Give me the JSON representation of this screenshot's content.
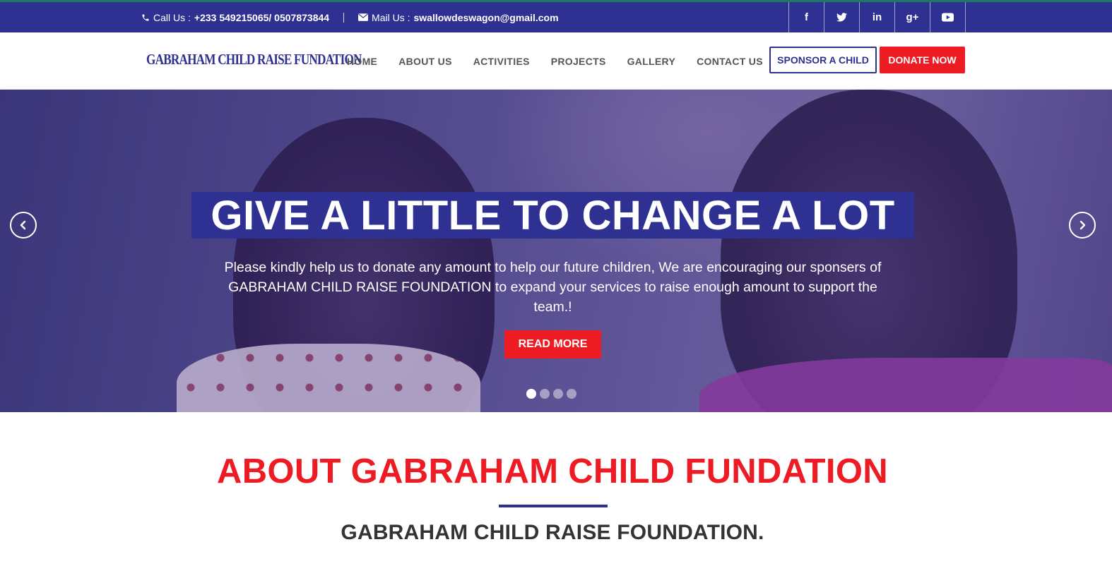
{
  "topbar": {
    "call_label": "Call Us :",
    "call_value": "+233 549215065/ 0507873844",
    "mail_label": "Mail Us :",
    "mail_value": "swallowdeswagon@gmail.com",
    "social": [
      {
        "icon": "facebook-icon",
        "glyph": "f"
      },
      {
        "icon": "twitter-icon",
        "glyph": "t"
      },
      {
        "icon": "linkedin-icon",
        "glyph": "in"
      },
      {
        "icon": "google-plus-icon",
        "glyph": "g+"
      },
      {
        "icon": "youtube-icon",
        "glyph": "▶"
      }
    ]
  },
  "nav": {
    "logo": "GABRAHAM CHILD RAISE FUNDATION",
    "menu": [
      "HOME",
      "ABOUT US",
      "ACTIVITIES",
      "PROJECTS",
      "GALLERY",
      "CONTACT US"
    ],
    "sponsor_label": "SPONSOR A CHILD",
    "donate_label": "DONATE NOW"
  },
  "hero": {
    "title": "GIVE A LITTLE TO CHANGE A LOT",
    "text": "Please kindly help us to donate any amount to help our future children, We are encouraging our sponsers of GABRAHAM CHILD RAISE FOUNDATION to expand your services to raise enough amount to support the team.!",
    "button": "READ MORE",
    "slides": 4,
    "active_slide": 1
  },
  "about": {
    "title": "ABOUT GABRAHAM CHILD FUNDATION",
    "subtitle": "GABRAHAM CHILD RAISE FOUNDATION."
  },
  "colors": {
    "brand_blue": "#2e3192",
    "brand_red": "#ed1c24"
  }
}
